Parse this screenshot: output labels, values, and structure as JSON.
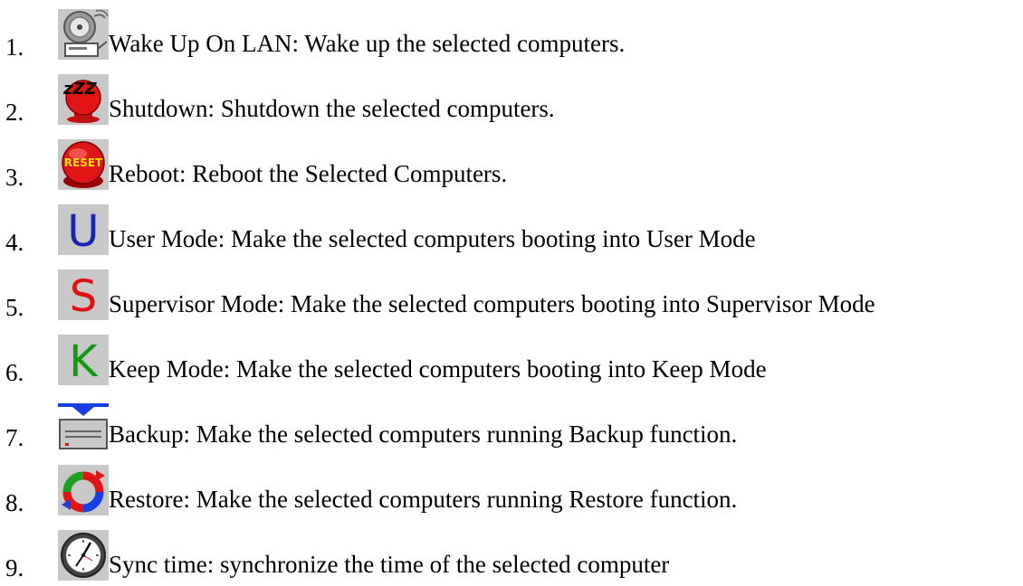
{
  "items": [
    {
      "num": "1.",
      "icon": "wake-on-lan-icon",
      "text": "Wake Up On LAN: Wake up the selected computers."
    },
    {
      "num": "2.",
      "icon": "shutdown-icon",
      "text": "Shutdown: Shutdown the selected computers."
    },
    {
      "num": "3.",
      "icon": "reset-icon",
      "text": "Reboot: Reboot the Selected Computers."
    },
    {
      "num": "4.",
      "icon": "user-mode-icon",
      "text": "User Mode: Make the selected computers booting into User Mode"
    },
    {
      "num": "5.",
      "icon": "supervisor-mode-icon",
      "text": "Supervisor Mode: Make the selected computers booting into Supervisor Mode"
    },
    {
      "num": "6.",
      "icon": "keep-mode-icon",
      "text": "Keep Mode: Make the selected computers booting into Keep Mode"
    },
    {
      "num": "7.",
      "icon": "backup-icon",
      "text": "Backup: Make the selected computers running Backup function."
    },
    {
      "num": "8.",
      "icon": "restore-icon",
      "text": "Restore: Make the selected computers running Restore function."
    },
    {
      "num": "9.",
      "icon": "clock-icon",
      "text": "Sync time: synchronize the time of the selected computer"
    }
  ],
  "icon_letters": {
    "user": "U",
    "supervisor": "S",
    "keep": "K",
    "reset": "RESET",
    "sleep": "zZZ"
  },
  "colors": {
    "icon_bg": "#c8c8c8",
    "user_letter": "#1a22b8",
    "supervisor_letter": "#e01010",
    "keep_letter": "#129a12",
    "reset_red": "#e01515"
  }
}
